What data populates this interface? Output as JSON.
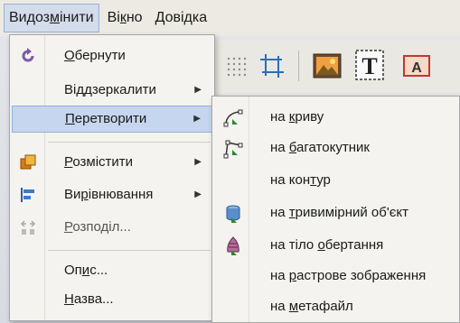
{
  "menubar": {
    "items": [
      {
        "label_pre": "Видоз",
        "label_u": "м",
        "label_post": "інити"
      },
      {
        "label_pre": "Ві",
        "label_u": "к",
        "label_post": "но"
      },
      {
        "label_pre": "",
        "label_u": "Д",
        "label_post": "овідка"
      }
    ]
  },
  "menu": {
    "items": [
      {
        "pre": "",
        "u": "О",
        "post": "бернути",
        "has_submenu": false,
        "icon": "rotate-icon"
      },
      {
        "pre": "Ві",
        "u": "д",
        "post": "дзеркалити",
        "has_submenu": true,
        "icon": ""
      },
      {
        "pre": "",
        "u": "П",
        "post": "еретворити",
        "has_submenu": true,
        "icon": ""
      },
      {
        "pre": "",
        "u": "Р",
        "post": "озмістити",
        "has_submenu": true,
        "icon": "arrange-icon"
      },
      {
        "pre": "Ви",
        "u": "р",
        "post": "івнювання",
        "has_submenu": true,
        "icon": "align-icon"
      },
      {
        "pre": "",
        "u": "Р",
        "post": "озподіл...",
        "has_submenu": false,
        "icon": "distribute-icon"
      },
      {
        "pre": "Оп",
        "u": "и",
        "post": "с...",
        "has_submenu": false,
        "icon": ""
      },
      {
        "pre": "",
        "u": "Н",
        "post": "азва...",
        "has_submenu": false,
        "icon": ""
      }
    ]
  },
  "submenu": {
    "items": [
      {
        "pre": "на ",
        "u": "к",
        "post": "риву",
        "icon": "curve-icon"
      },
      {
        "pre": "на ",
        "u": "б",
        "post": "агатокутник",
        "icon": "polygon-icon"
      },
      {
        "pre": "на кон",
        "u": "т",
        "post": "ур",
        "icon": ""
      },
      {
        "pre": "на ",
        "u": "т",
        "post": "ривимірний об'єкт",
        "icon": "3d-object-icon"
      },
      {
        "pre": "на тіло ",
        "u": "о",
        "post": "бертання",
        "icon": "rotation-body-icon"
      },
      {
        "pre": "на ",
        "u": "р",
        "post": "астрове зображення",
        "icon": ""
      },
      {
        "pre": "на ",
        "u": "м",
        "post": "етафайл",
        "icon": ""
      }
    ]
  },
  "colors": {
    "highlight": "#c5d6ee",
    "menu_bg": "#f4f3ef",
    "menubar_bg": "#eceae3"
  }
}
